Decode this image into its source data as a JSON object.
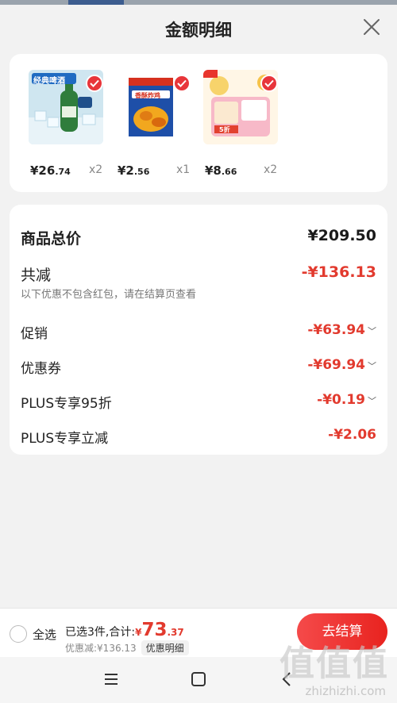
{
  "header": {
    "title": "金额明细"
  },
  "products": [
    {
      "price_main": "¥26",
      "price_dec": ".74",
      "qty": "x2",
      "image_label": "经典啤酒"
    },
    {
      "price_main": "¥2",
      "price_dec": ".56",
      "qty": "x1",
      "image_label": "香酥炸鸡"
    },
    {
      "price_main": "¥8",
      "price_dec": ".66",
      "qty": "x2",
      "image_label": "5折"
    }
  ],
  "summary": {
    "total_label": "商品总价",
    "total_value": "¥209.50",
    "reduce_label": "共减",
    "reduce_value": "-¥136.13",
    "note": "以下优惠不包含红包，请在结算页查看",
    "items": [
      {
        "label": "促销",
        "value": "-¥63.94",
        "chev": "﹀"
      },
      {
        "label": "优惠券",
        "value": "-¥69.94",
        "chev": "﹀"
      },
      {
        "label": "PLUS专享95折",
        "value": "-¥0.19",
        "chev": "﹀"
      },
      {
        "label": "PLUS专享立减",
        "value": "-¥2.06",
        "chev": ""
      }
    ]
  },
  "bottom": {
    "select_all": "全选",
    "selected_text": "已选3件,合计:",
    "total_prefix": "¥",
    "total_int": "73",
    "total_dec": ".37",
    "discount_text": "优惠减:¥136.13",
    "detail_tag": "优惠明细",
    "checkout": "去结算"
  },
  "watermark": {
    "logo": "值值值",
    "url": "zhizhizhi.com"
  },
  "colors": {
    "accent": "#e23a2e",
    "checkout": "#e8231f"
  }
}
